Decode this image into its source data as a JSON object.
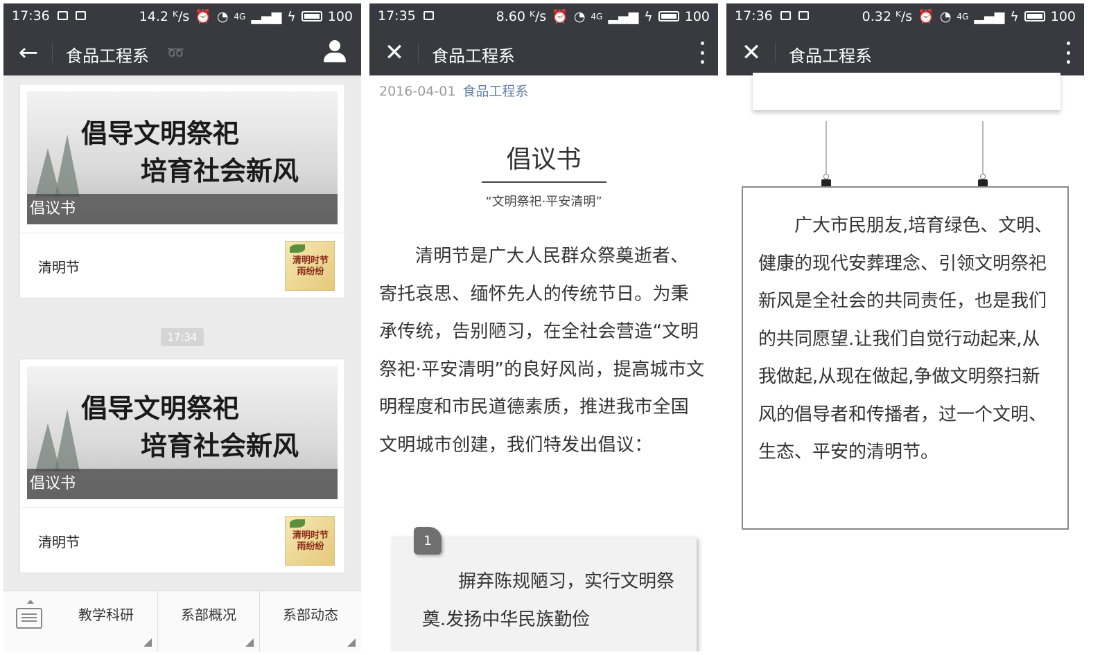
{
  "panel1": {
    "status": {
      "time": "17:36",
      "speed": "14.2 ᴷ/s",
      "network": "4G",
      "battery": "100"
    },
    "nav": {
      "title": "食品工程系"
    },
    "cards": [
      {
        "banner_line1": "倡导文明祭祀",
        "banner_line2": "培育社会新风",
        "banner_caption": "倡议书",
        "item_title": "清明节",
        "thumb_text": "清明时节 雨纷纷"
      },
      {
        "banner_line1": "倡导文明祭祀",
        "banner_line2": "培育社会新风",
        "banner_caption": "倡议书",
        "item_title": "清明节",
        "thumb_text": "清明时节 雨纷纷"
      }
    ],
    "time_badge": "17:34",
    "menu": [
      "教学科研",
      "系部概况",
      "系部动态"
    ]
  },
  "panel2": {
    "status": {
      "time": "17:35",
      "speed": "8.60 ᴷ/s",
      "network": "4G",
      "battery": "100"
    },
    "nav": {
      "title": "食品工程系"
    },
    "date": "2016-04-01",
    "account": "食品工程系",
    "doc_title": "倡议书",
    "doc_subtitle": "“文明祭祀·平安清明”",
    "paragraph": "清明节是广大人民群众祭奠逝者、寄托哀思、缅怀先人的传统节日。为秉承传统，告别陋习，在全社会营造“文明祭祀·平安清明”的良好风尚，提高城市文明程度和市民道德素质，推进我市全国文明城市创建，我们特发出倡议：",
    "item_number": "1",
    "item_text": "摒弃陈规陋习，实行文明祭奠.发扬中华民族勤俭"
  },
  "panel3": {
    "status": {
      "time": "17:36",
      "speed": "0.32 ᴷ/s",
      "network": "4G",
      "battery": "100"
    },
    "nav": {
      "title": "食品工程系"
    },
    "notice_text": "广大市民朋友,培育绿色、文明、健康的现代安葬理念、引领文明祭祀新风是全社会的共同责任，也是我们的共同愿望.让我们自觉行动起来,从我做起,从现在做起,争做文明祭扫新风的倡导者和传播者，过一个文明、生态、平安的清明节。"
  },
  "colors": {
    "bar": "#393a3f",
    "accent_link": "#607fa6",
    "chat_bg": "#ebebeb"
  }
}
